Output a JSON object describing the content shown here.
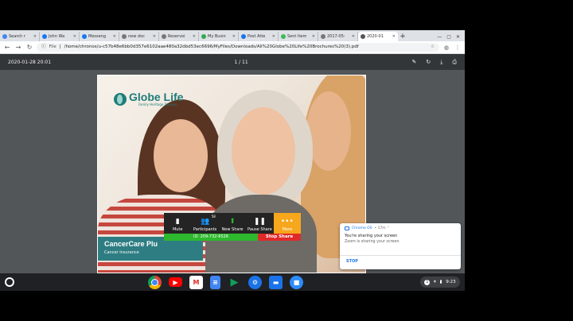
{
  "browser": {
    "tabs": [
      {
        "label": "Search r",
        "fav_color": "#4285f4"
      },
      {
        "label": "John Wa",
        "fav_color": "#1877f2"
      },
      {
        "label": "Messeng",
        "fav_color": "#1877f2"
      },
      {
        "label": "new doc",
        "fav_color": "#777777"
      },
      {
        "label": "Reservoi",
        "fav_color": "#777777"
      },
      {
        "label": "My Busin",
        "fav_color": "#34a853"
      },
      {
        "label": "Post Atte",
        "fav_color": "#1a73e8"
      },
      {
        "label": "Sent Item",
        "fav_color": "#3cba54"
      },
      {
        "label": "2017-05-",
        "fav_color": "#777777"
      },
      {
        "label": "2020-01",
        "fav_color": "#555555",
        "active": true
      }
    ],
    "new_tab_label": "+",
    "window_controls": [
      "—",
      "▢",
      "✕"
    ],
    "address": {
      "scheme_label": "File",
      "url": "/home/chronos/u-c57b48e6bb0d357e6102aae480a32dbd53ec6696/MyFiles/Downloads/All%20Globe%20Life%20Brochures%20(3).pdf"
    }
  },
  "pdf_viewer": {
    "title": "2020-01-28 20:01",
    "page_indicator": "1 / 11"
  },
  "document": {
    "brand": "Globe Life",
    "division": "Family Heritage Division",
    "banner_title": "CancerCare Plu",
    "banner_subtitle": "Cancer Insurance"
  },
  "zoom": {
    "buttons": {
      "mute": "Mute",
      "participants": "Participants",
      "new_share": "New Share",
      "pause_share": "Pause Share",
      "more": "More"
    },
    "participant_count": "58",
    "meeting_id": "ID: 209-732-6526",
    "stop_share": "Stop Share",
    "colors": {
      "bar": "#242424",
      "share_green": "#2eb82e",
      "stop_red": "#e02a2a",
      "more_orange": "#f6a71c"
    }
  },
  "notification": {
    "app_name": "Chrome OS",
    "time": "• 17m ⌃",
    "title": "You're sharing your screen",
    "body": "Zoom is sharing your screen.",
    "action": "STOP"
  },
  "shelf": {
    "apps": [
      "chrome",
      "youtube",
      "gmail",
      "docs",
      "play-store",
      "settings",
      "files",
      "zoom"
    ],
    "clock": "9:23"
  }
}
